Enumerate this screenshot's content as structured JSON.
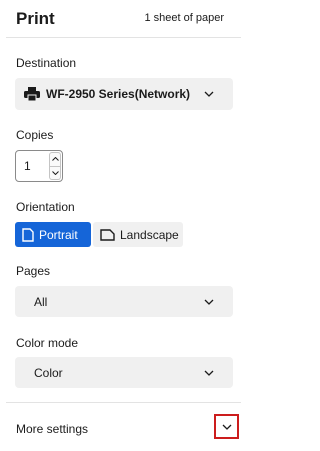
{
  "header": {
    "title": "Print",
    "sheet_count": "1 sheet of paper"
  },
  "destination": {
    "label": "Destination",
    "value": "WF-2950 Series(Network)",
    "icon": "printer-icon"
  },
  "copies": {
    "label": "Copies",
    "value": "1"
  },
  "orientation": {
    "label": "Orientation",
    "options": [
      {
        "label": "Portrait",
        "selected": true,
        "icon": "portrait-icon"
      },
      {
        "label": "Landscape",
        "selected": false,
        "icon": "landscape-icon"
      }
    ]
  },
  "pages": {
    "label": "Pages",
    "value": "All"
  },
  "color_mode": {
    "label": "Color mode",
    "value": "Color"
  },
  "more_settings": {
    "label": "More settings"
  },
  "colors": {
    "accent": "#1565d8",
    "highlight_border": "#cc1d1d",
    "field_bg": "#f0f0f0"
  }
}
